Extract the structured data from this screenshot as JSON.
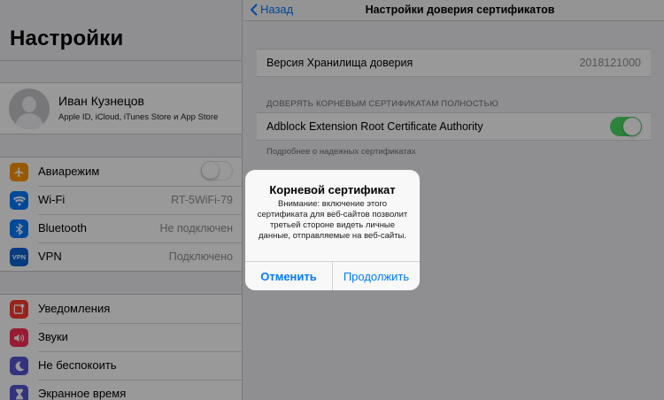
{
  "sidebar": {
    "title": "Настройки",
    "profile": {
      "name": "Иван Кузнецов",
      "subtitle": "Apple ID, iCloud, iTunes Store и App Store"
    },
    "group1": [
      {
        "label": "Авиарежим",
        "icon": "airplane-icon",
        "color": "#ff9500",
        "toggle": false
      },
      {
        "label": "Wi-Fi",
        "icon": "wifi-icon",
        "color": "#007aff",
        "value": "RT-5WiFi-79"
      },
      {
        "label": "Bluetooth",
        "icon": "bluetooth-icon",
        "color": "#007aff",
        "value": "Не подключен"
      },
      {
        "label": "VPN",
        "icon": "vpn-icon",
        "icon_text": "VPN",
        "color": "#0a63d1",
        "value": "Подключено"
      }
    ],
    "group2": [
      {
        "label": "Уведомления",
        "icon": "notifications-icon",
        "color": "#ff3b30"
      },
      {
        "label": "Звуки",
        "icon": "sounds-icon",
        "color": "#ff2d55"
      },
      {
        "label": "Не беспокоить",
        "icon": "moon-icon",
        "color": "#5856d6"
      },
      {
        "label": "Экранное время",
        "icon": "hourglass-icon",
        "color": "#5856d6"
      }
    ]
  },
  "detail": {
    "back_label": "Назад",
    "title": "Настройки доверия сертификатов",
    "trust_store_label": "Версия Хранилища доверия",
    "trust_store_value": "2018121000",
    "section_header": "ДОВЕРЯТЬ КОРНЕВЫМ СЕРТИФИКАТАМ ПОЛНОСТЬЮ",
    "certificate_name": "Adblock Extension Root Certificate Authority",
    "certificate_enabled": true,
    "section_footer": "Подробнее о надежных сертификатах"
  },
  "alert": {
    "title": "Корневой сертификат",
    "message": "Внимание: включение этого сертификата для веб-сайтов позволит третьей стороне видеть личные данные, отправляемые на веб-сайты.",
    "cancel_label": "Отменить",
    "continue_label": "Продолжить"
  },
  "colors": {
    "accent": "#007aff",
    "toggle_on": "#4cd964"
  }
}
